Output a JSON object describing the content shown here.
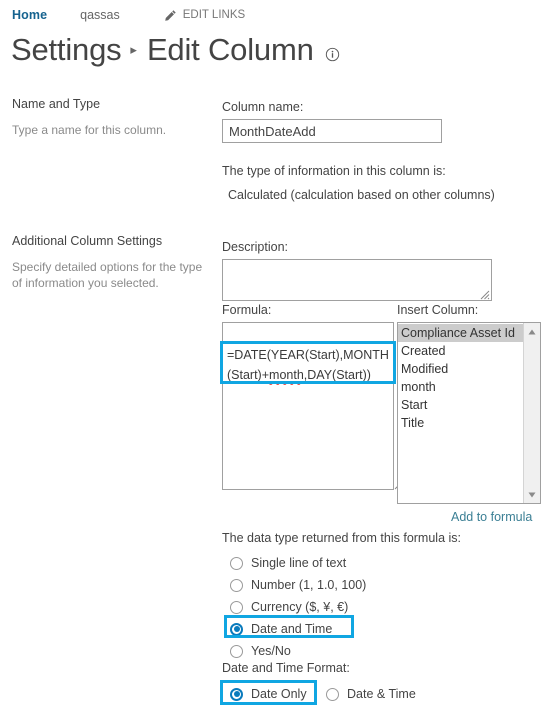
{
  "topnav": {
    "home_label": "Home",
    "site_label": "qassas",
    "edit_links_label": "EDIT LINKS",
    "pencil_icon": "pencil-icon"
  },
  "header": {
    "breadcrumb_settings": "Settings",
    "separator": "▸",
    "page_title": "Edit Column",
    "info_icon": "info-icon"
  },
  "sections": [
    {
      "heading": "Name and Type",
      "description": "Type a name for this column."
    },
    {
      "heading": "Additional Column Settings",
      "description": "Specify detailed options for the type of information you selected."
    }
  ],
  "form": {
    "column_name_label": "Column name:",
    "column_name_value": "MonthDateAdd",
    "type_info_label": "The type of information in this column is:",
    "type_info_value": "Calculated (calculation based on other columns)",
    "description_label": "Description:",
    "description_value": "",
    "formula_label": "Formula:",
    "formula_value": "=DATE(YEAR(Start),MONTH(Start)+month,DAY(Start))",
    "formula_line1": "=DATE(YEAR(Start),MONTH",
    "formula_line2_pre": "(Start)+",
    "formula_line2_misspelled": "month",
    "formula_line2_post": ",DAY(Start))",
    "insert_column_label": "Insert Column:",
    "insert_column_options": [
      "Compliance Asset Id",
      "Created",
      "Modified",
      "month",
      "Start",
      "Title"
    ],
    "insert_column_selected": "Compliance Asset Id",
    "add_to_formula_label": "Add to formula",
    "scroll_up_icon": "scroll-up-arrow-icon",
    "scroll_down_icon": "scroll-down-arrow-icon",
    "resize_grip_icon": "resize-grip-icon"
  },
  "datatype": {
    "label": "The data type returned from this formula is:",
    "options": [
      {
        "label": "Single line of text",
        "checked": false
      },
      {
        "label": "Number (1, 1.0, 100)",
        "checked": false
      },
      {
        "label": "Currency ($, ¥, €)",
        "checked": false
      },
      {
        "label": "Date and Time",
        "checked": true
      },
      {
        "label": "Yes/No",
        "checked": false
      }
    ]
  },
  "datetime_format": {
    "label": "Date and Time Format:",
    "options": [
      {
        "label": "Date Only",
        "checked": true
      },
      {
        "label": "Date & Time",
        "checked": false
      }
    ]
  },
  "colors": {
    "annotation": "#10a6e2",
    "link": "#16638f",
    "secondary_link": "#3b7f94",
    "radio_accent": "#0a7bbd",
    "text": "#444444",
    "muted_text": "#8a8a8a",
    "selection": "#cccccc",
    "misspelling_underline": "#e03131"
  }
}
